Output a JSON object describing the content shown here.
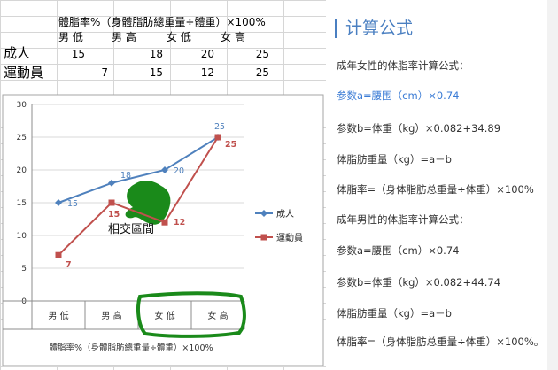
{
  "sheet": {
    "header_formula": "體脂率%（身體脂肪總重量÷體重）×100%",
    "col_headers": [
      "男 低",
      "男 高",
      "女 低",
      "女 高"
    ],
    "rows": [
      {
        "label": "成人",
        "values": [
          "15",
          "18",
          "20",
          "25"
        ]
      },
      {
        "label": "運動員",
        "values": [
          "7",
          "15",
          "12",
          "25"
        ]
      }
    ]
  },
  "chart_data": {
    "type": "line",
    "categories": [
      "男 低",
      "男 高",
      "女 低",
      "女 高"
    ],
    "series": [
      {
        "name": "成人",
        "values": [
          15,
          18,
          20,
          25
        ],
        "color": "#4f81bd",
        "labels": [
          "15",
          "18",
          "20",
          "25"
        ]
      },
      {
        "name": "運動員",
        "values": [
          7,
          15,
          12,
          25
        ],
        "color": "#c0504d",
        "labels": [
          "7",
          "15",
          "12",
          "25"
        ]
      }
    ],
    "ylim": [
      0,
      30
    ],
    "yticks": [
      "0",
      "5",
      "10",
      "15",
      "20",
      "25",
      "30"
    ],
    "xlabel": "體脂率%（身體脂肪總重量÷體重）×100%",
    "annotation": "相交區間",
    "legend_position": "right",
    "grid": true
  },
  "panel": {
    "title": "计算公式",
    "lines": [
      {
        "text": "成年女性的体脂率计算公式：",
        "highlight": false
      },
      {
        "text": "参数a=腰围（cm）×0.74",
        "highlight": true
      },
      {
        "text": "参数b=体重（kg）×0.082+34.89",
        "highlight": false
      },
      {
        "text": "体脂肪重量（kg）=a－b",
        "highlight": false
      },
      {
        "text": "体脂率=（身体脂肪总重量÷体重）×100%",
        "highlight": false
      },
      {
        "text": "成年男性的体脂率计算公式：",
        "highlight": false
      },
      {
        "text": "参数a=腰围（cm）×0.74",
        "highlight": false
      },
      {
        "text": "参数b=体重（kg）×0.082+44.74",
        "highlight": false
      },
      {
        "text": "体脂肪重量（kg）=a－b",
        "highlight": false
      },
      {
        "text": "体脂率=（身体脂肪总重量÷体重）×100%。",
        "highlight": false
      }
    ]
  },
  "colors": {
    "accent": "#4a7fc1",
    "series1": "#4f81bd",
    "series2": "#c0504d",
    "marker_green": "#1a8a1a"
  }
}
